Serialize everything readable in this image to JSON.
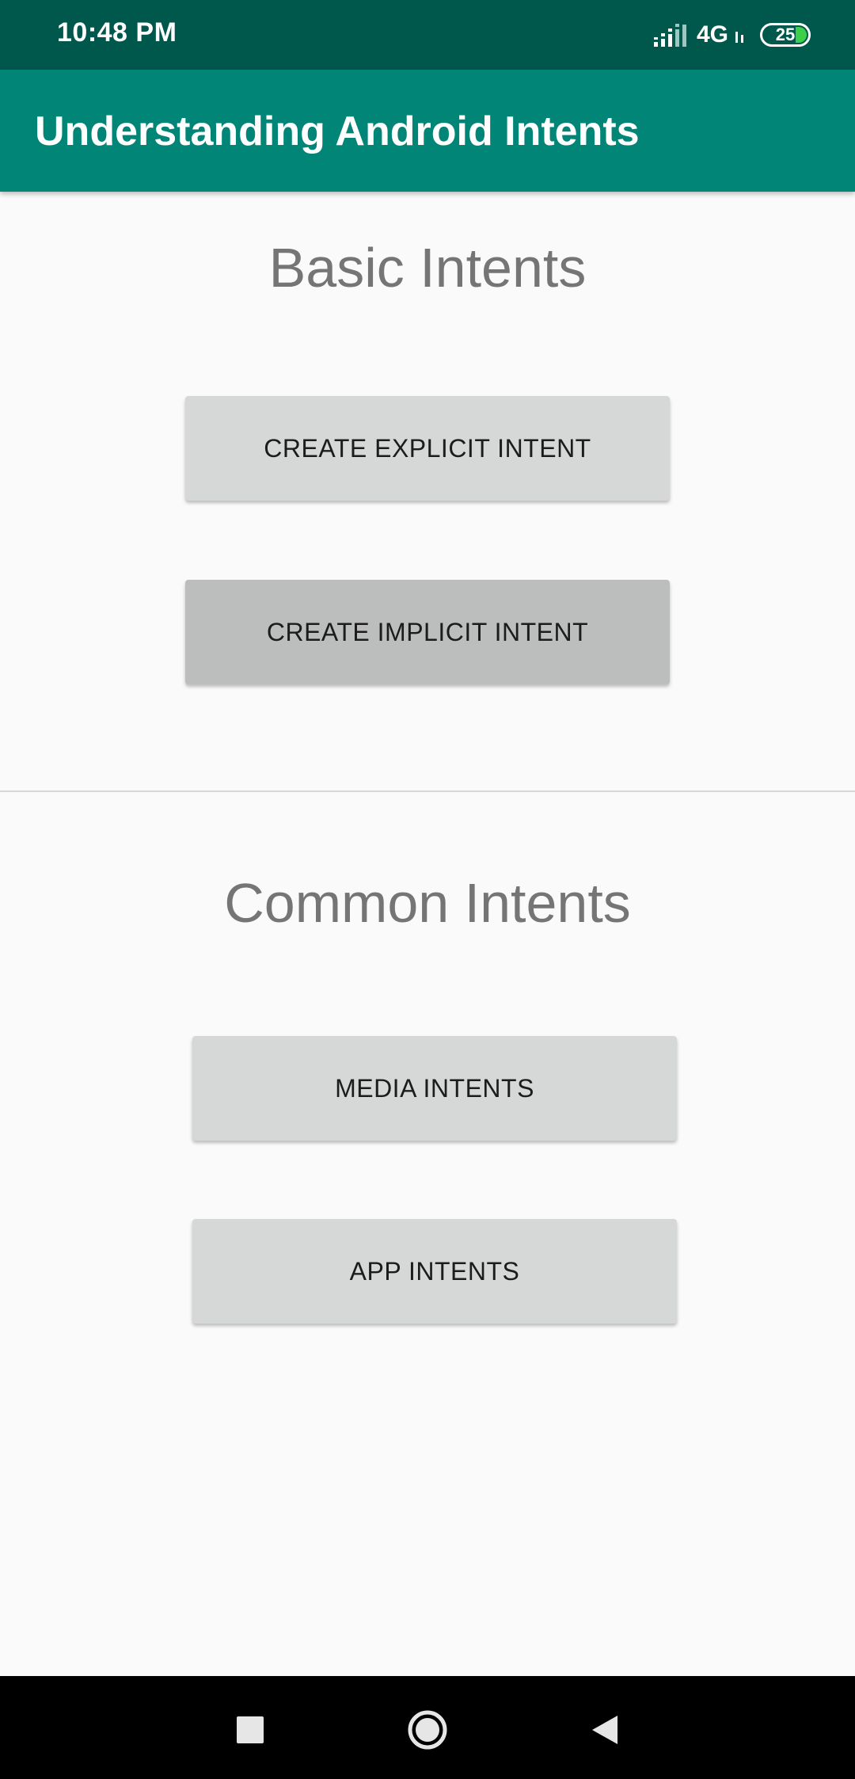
{
  "status_bar": {
    "time": "10:48 PM",
    "network": "4G",
    "battery": "25",
    "battery_color": "#3ecf4a"
  },
  "app_bar": {
    "title": "Understanding Android Intents",
    "color": "#008577"
  },
  "sections": [
    {
      "title": "Basic Intents",
      "buttons": [
        {
          "label": "CREATE EXPLICIT INTENT"
        },
        {
          "label": "CREATE IMPLICIT INTENT"
        }
      ]
    },
    {
      "title": "Common Intents",
      "buttons": [
        {
          "label": "MEDIA INTENTS"
        },
        {
          "label": "APP INTENTS"
        }
      ]
    }
  ],
  "nav_bar": {
    "icons": [
      "recents-icon",
      "home-icon",
      "back-icon"
    ]
  }
}
